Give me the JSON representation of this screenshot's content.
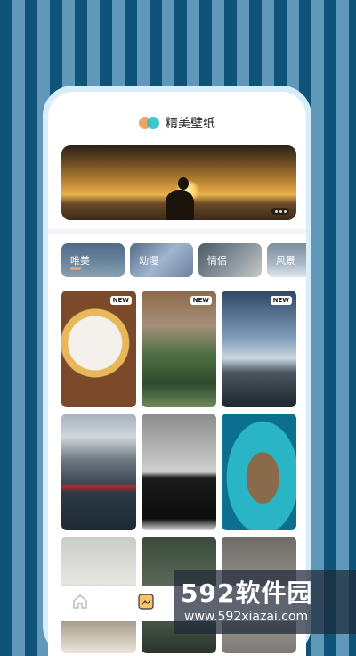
{
  "app": {
    "title": "精美壁纸"
  },
  "banner": {
    "indicator_dots": 3
  },
  "categories": [
    {
      "label": "唯美",
      "active": true
    },
    {
      "label": "动漫",
      "active": false
    },
    {
      "label": "情侣",
      "active": false
    },
    {
      "label": "风景",
      "active": false
    }
  ],
  "wallpapers": [
    {
      "subject": "food",
      "badge": "NEW"
    },
    {
      "subject": "greenhouse",
      "badge": "NEW"
    },
    {
      "subject": "city road",
      "badge": "NEW"
    },
    {
      "subject": "mountain boat",
      "badge": ""
    },
    {
      "subject": "black and white",
      "badge": ""
    },
    {
      "subject": "sea rock",
      "badge": ""
    },
    {
      "subject": "winter animal",
      "badge": ""
    },
    {
      "subject": "tree",
      "badge": ""
    },
    {
      "subject": "misc",
      "badge": ""
    }
  ],
  "tabbar": {
    "items": [
      "home-icon",
      "wallpaper-icon"
    ]
  },
  "watermark": {
    "brand": "592软件园",
    "url": "www.592xiazai.com"
  },
  "colors": {
    "accent": "#f4a062",
    "logo_orange": "#f0a45f",
    "logo_teal": "#2ec3c9"
  }
}
